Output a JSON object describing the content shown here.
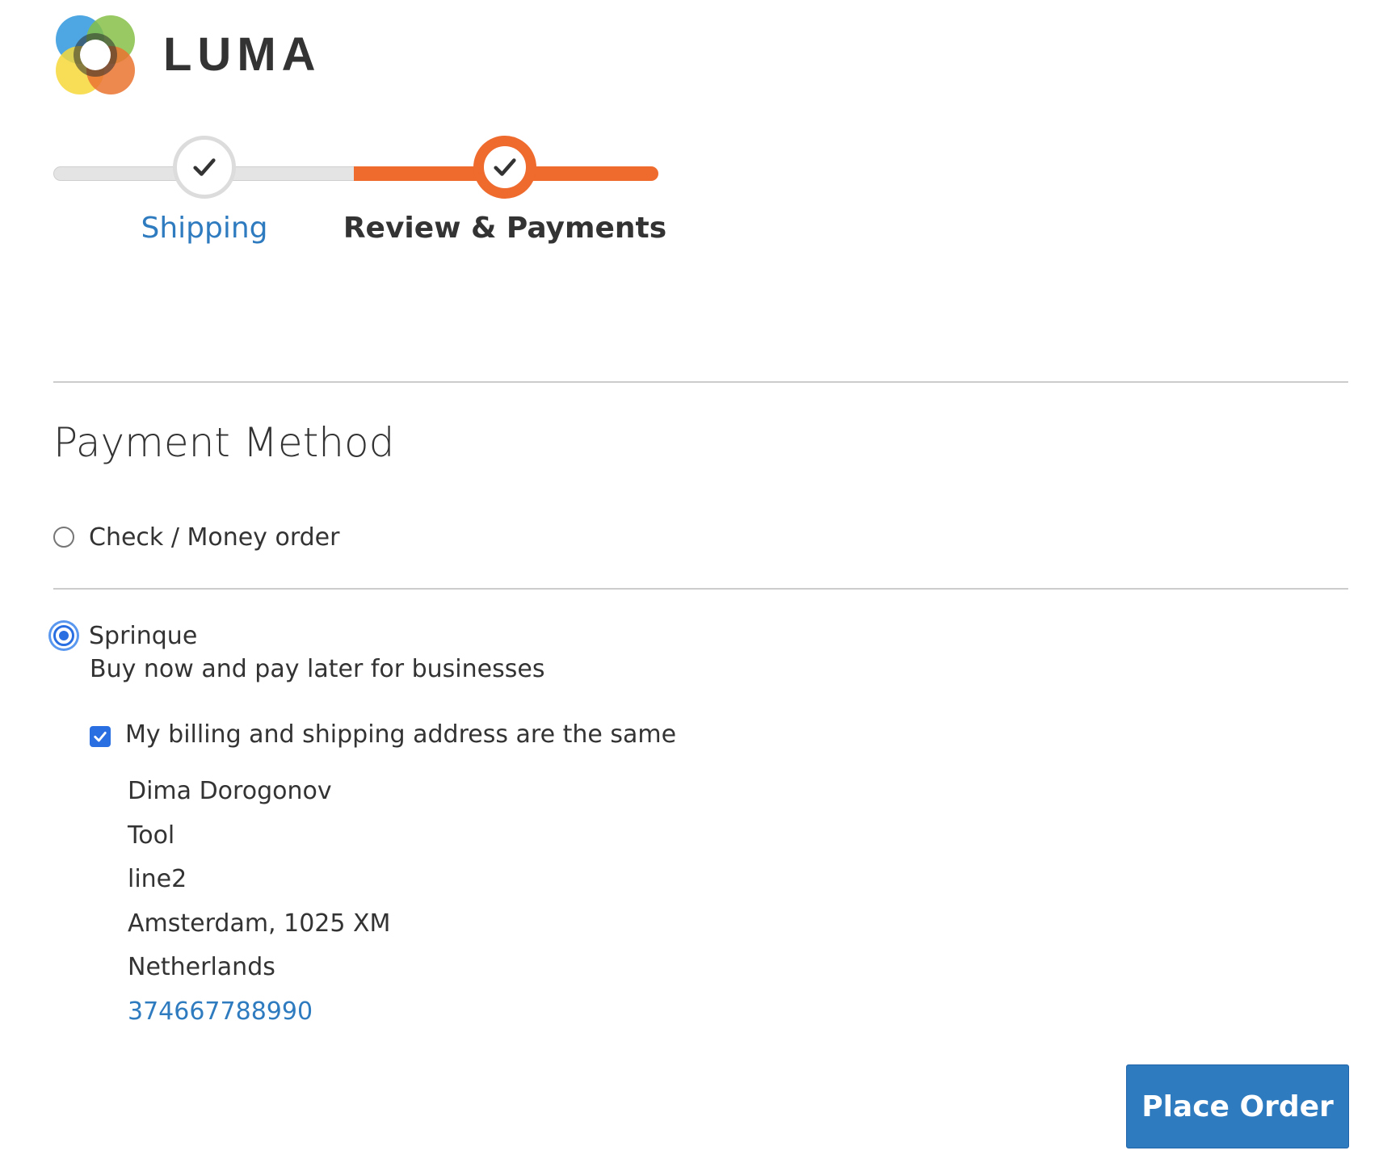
{
  "brand": {
    "name": "LUMA",
    "logo_icon": "luma-logo-icon",
    "colors": {
      "blue": "#3f9fe0",
      "green": "#86c047",
      "yellow": "#f7d83a",
      "orange": "#ea7330",
      "center": "#2b2b2b"
    }
  },
  "progress": {
    "steps": [
      {
        "label": "Shipping",
        "status": "complete"
      },
      {
        "label": "Review & Payments",
        "status": "active"
      }
    ],
    "colors": {
      "active": "#ee6a2d",
      "inactive": "#e4e4e4",
      "link": "#2f7bbf"
    }
  },
  "payment": {
    "title": "Payment Method",
    "methods": [
      {
        "label": "Check / Money order",
        "selected": false
      },
      {
        "label": "Sprinque",
        "description": "Buy now and pay later for businesses",
        "selected": true
      }
    ],
    "billing_same": {
      "label": "My billing and shipping address are the same",
      "checked": true
    },
    "address": {
      "name": "Dima Dorogonov",
      "company": "Tool",
      "street": "line2",
      "city_line": "Amsterdam, 1025 XM",
      "country": "Netherlands",
      "phone": "374667788990"
    },
    "place_order_label": "Place Order",
    "accent_color": "#2f7bbf",
    "control_color": "#2a6fe2"
  }
}
